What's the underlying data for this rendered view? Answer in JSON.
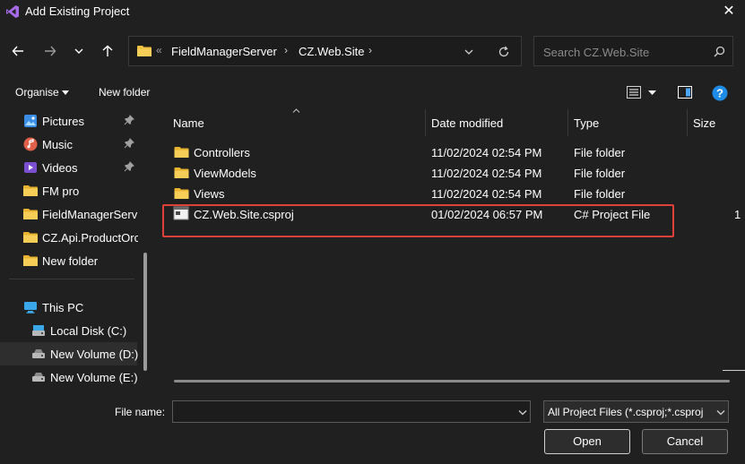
{
  "window": {
    "title": "Add Existing Project"
  },
  "address": {
    "overflow": "«",
    "segments": [
      "FieldManagerServer",
      "CZ.Web.Site"
    ]
  },
  "search": {
    "placeholder": "Search CZ.Web.Site"
  },
  "toolbar": {
    "organise_label": "Organise",
    "new_folder_label": "New folder"
  },
  "sidebar": {
    "items": [
      {
        "label": "Pictures",
        "icon": "pictures-icon",
        "pinned": true
      },
      {
        "label": "Music",
        "icon": "music-icon",
        "pinned": true
      },
      {
        "label": "Videos",
        "icon": "videos-icon",
        "pinned": true
      },
      {
        "label": "FM pro",
        "icon": "folder-icon",
        "pinned": false
      },
      {
        "label": "FieldManagerServ",
        "icon": "folder-icon",
        "pinned": false
      },
      {
        "label": "CZ.Api.ProductOrc",
        "icon": "folder-icon",
        "pinned": false
      },
      {
        "label": "New folder",
        "icon": "folder-icon",
        "pinned": false
      }
    ],
    "this_pc": "This PC",
    "drives": [
      {
        "label": "Local Disk (C:)"
      },
      {
        "label": "New Volume (D:)"
      },
      {
        "label": "New Volume (E:)"
      }
    ]
  },
  "columns": {
    "name": "Name",
    "date": "Date modified",
    "type": "Type",
    "size": "Size"
  },
  "files": [
    {
      "name": "Controllers",
      "date": "11/02/2024 02:54 PM",
      "type": "File folder",
      "size": "",
      "kind": "folder"
    },
    {
      "name": "ViewModels",
      "date": "11/02/2024 02:54 PM",
      "type": "File folder",
      "size": "",
      "kind": "folder"
    },
    {
      "name": "Views",
      "date": "11/02/2024 02:54 PM",
      "type": "File folder",
      "size": "",
      "kind": "folder"
    },
    {
      "name": "CZ.Web.Site.csproj",
      "date": "01/02/2024 06:57 PM",
      "type": "C# Project File",
      "size": "1",
      "kind": "file"
    }
  ],
  "footer": {
    "file_name_label": "File name:",
    "file_name_value": "",
    "filter_value": "All Project Files (*.csproj;*.csproj",
    "open_label": "Open",
    "cancel_label": "Cancel"
  },
  "colors": {
    "background": "#202020",
    "highlight": "#e0403a",
    "help_blue": "#1e8ce6"
  }
}
